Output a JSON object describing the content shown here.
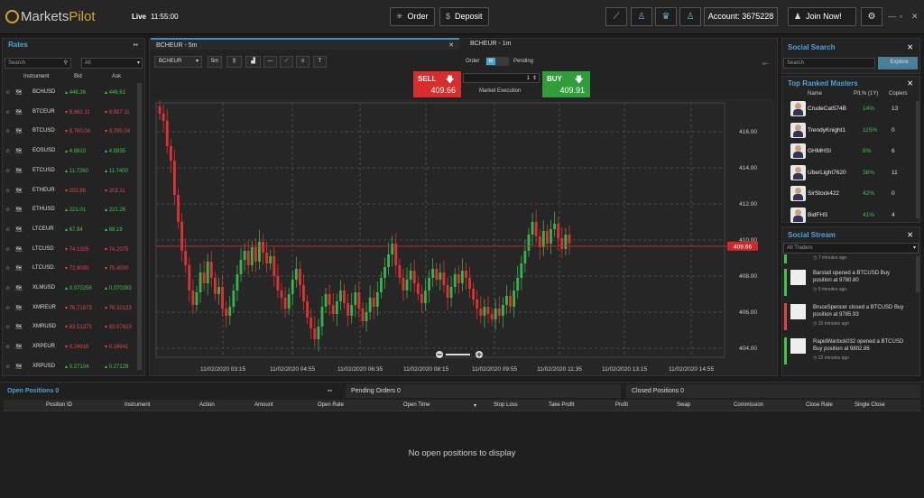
{
  "header": {
    "logo_markets": "Markets",
    "logo_pilot": "Pilot",
    "live": "Live",
    "time": "11:55:00",
    "order": "Order",
    "deposit": "Deposit",
    "account": "Account: 3675228",
    "join": "Join Now!"
  },
  "rates": {
    "title": "Rates",
    "search_placeholder": "Search",
    "filter": "All",
    "col_instrument": "Instrument",
    "col_bid": "Bid",
    "col_ask": "Ask",
    "rows": [
      {
        "inst": "BCHUSD",
        "bid": "446.36",
        "ask": "446.61",
        "dir": "up"
      },
      {
        "inst": "BTCEUR",
        "bid": "8,862.11",
        "ask": "8,887.11",
        "dir": "dn"
      },
      {
        "inst": "BTCUSD",
        "bid": "9,760.04",
        "ask": "9,785.04",
        "dir": "dn"
      },
      {
        "inst": "EOSUSD",
        "bid": "4.8910",
        "ask": "4.8935",
        "dir": "up"
      },
      {
        "inst": "ETCUSD",
        "bid": "11.7260",
        "ask": "11.7400",
        "dir": "up"
      },
      {
        "inst": "ETHEUR",
        "bid": "202.86",
        "ask": "203.11",
        "dir": "dn"
      },
      {
        "inst": "ETHUSD",
        "bid": "221.01",
        "ask": "221.26",
        "dir": "up"
      },
      {
        "inst": "LTCEUR",
        "bid": "67.94",
        "ask": "68.19",
        "dir": "up"
      },
      {
        "inst": "LTCUSD",
        "bid": "74.1325",
        "ask": "74.2075",
        "dir": "dn"
      },
      {
        "inst": "LTCUSD.",
        "bid": "72.9000",
        "ask": "75.4000",
        "dir": "dn"
      },
      {
        "inst": "XLMUSD",
        "bid": "0.070258",
        "ask": "0.070283",
        "dir": "up"
      },
      {
        "inst": "XMREUR",
        "bid": "76.71873",
        "ask": "76.32123",
        "dir": "dn"
      },
      {
        "inst": "XMRUSD",
        "bid": "83.51373",
        "ask": "83.57623",
        "dir": "dn"
      },
      {
        "inst": "XRPEUR",
        "bid": "0.24916",
        "ask": "0.24941",
        "dir": "dn"
      },
      {
        "inst": "XRPUSD",
        "bid": "0.27104",
        "ask": "0.27129",
        "dir": "up"
      }
    ]
  },
  "tabs": [
    {
      "label": "BCHEUR - 5m"
    },
    {
      "label": "BCHEUR - 1m"
    }
  ],
  "toolbar": {
    "symbol": "BCHEUR",
    "interval": "5m",
    "text_tool": "T"
  },
  "trade": {
    "sell_label": "SELL",
    "sell_price": "409.66",
    "buy_label": "BUY",
    "buy_price": "409.91",
    "order": "Order",
    "toggle": "M",
    "pending": "Pending",
    "qty": "1",
    "execution": "Market Execution"
  },
  "chart_data": {
    "type": "candlestick",
    "ylim": [
      403.5,
      417.6
    ],
    "yticks": [
      "416.00",
      "414.00",
      "412.00",
      "410.00",
      "408.00",
      "406.00",
      "404.00"
    ],
    "xticks": [
      "11/02/2020 03:15",
      "11/02/2020 04:55",
      "11/02/2020 06:35",
      "11/02/2020 08:15",
      "11/02/2020 09:55",
      "11/02/2020 11:35",
      "11/02/2020 13:15",
      "11/02/2020 14:55"
    ],
    "current_price": 409.66,
    "current_label": "409.66",
    "close": [
      417.0,
      416.6,
      415.2,
      414.4,
      412.5,
      411.0,
      409.4,
      408.6,
      407.2,
      406.4,
      407.1,
      408.2,
      407.6,
      408.8,
      407.9,
      407.0,
      407.4,
      406.2,
      405.8,
      406.3,
      407.2,
      408.1,
      408.9,
      409.4,
      408.6,
      409.6,
      408.8,
      409.9,
      409.3,
      408.7,
      409.1,
      408.0,
      407.2,
      406.8,
      406.2,
      407.0,
      407.8,
      408.4,
      407.5,
      406.6,
      405.7,
      405.1,
      404.5,
      405.2,
      406.3,
      407.0,
      406.4,
      405.9,
      406.6,
      407.2,
      406.5,
      405.8,
      406.4,
      407.1,
      406.2,
      405.5,
      406.0,
      406.8,
      406.3,
      407.1,
      407.9,
      408.5,
      409.2,
      409.8,
      408.6,
      407.9,
      407.2,
      407.8,
      408.3,
      407.6,
      407.0,
      406.5,
      407.2,
      407.9,
      408.4,
      407.8,
      408.2,
      407.5,
      406.8,
      407.4,
      408.1,
      407.6,
      408.3,
      407.9,
      407.3,
      406.7,
      406.2,
      405.8,
      406.3,
      405.9,
      405.6,
      406.2,
      405.8,
      406.4,
      406.9,
      406.3,
      407.2,
      407.9,
      408.7,
      409.4,
      410.3,
      411.0,
      410.2,
      409.6,
      410.5,
      409.8,
      410.6,
      410.9,
      410.1,
      409.5,
      410.3,
      409.8
    ]
  },
  "social_search": {
    "title": "Social Search",
    "placeholder": "Search",
    "explore": "Explore"
  },
  "masters": {
    "title": "Top Ranked Masters",
    "col_name": "Name",
    "col_pl": "P/L% (1Y)",
    "col_copiers": "Copiers",
    "rows": [
      {
        "name": "CrudeCat574B",
        "pl": "14%",
        "copiers": "13"
      },
      {
        "name": "TrendyKnight1",
        "pl": "115%",
        "copiers": "0"
      },
      {
        "name": "GHMHSI",
        "pl": "8%",
        "copiers": "6"
      },
      {
        "name": "UberLight7620",
        "pl": "36%",
        "copiers": "11"
      },
      {
        "name": "SirStock422",
        "pl": "42%",
        "copiers": "0"
      },
      {
        "name": "BidFHS",
        "pl": "41%",
        "copiers": "4"
      }
    ]
  },
  "stream": {
    "title": "Social Stream",
    "filter": "All Traders",
    "items": [
      {
        "text": "",
        "time": "7 minutes ago",
        "color": "#3ec64a"
      },
      {
        "text": "Barstall opened a BTCUSD Buy position at 9780.80",
        "time": "9 minutes ago",
        "color": "#3ec64a"
      },
      {
        "text": "BruceSpencer closed a BTCUSD Buy position at 9785.93",
        "time": "15 minutes ago",
        "color": "#e24444"
      },
      {
        "text": "RapidWarlock032 opened a BTCUSD Buy position at 9802.86",
        "time": "22 minutes ago",
        "color": "#3ec64a"
      }
    ]
  },
  "bottom": {
    "open_positions": "Open Positions",
    "open_count": "0",
    "pending_orders": "Pending Orders",
    "pending_count": "0",
    "closed_positions": "Closed Positions",
    "closed_count": "0",
    "cols": [
      "Position ID",
      "Instrument",
      "Action",
      "Amount",
      "Open Rate",
      "Open Time",
      "Stop Loss",
      "Take Profit",
      "Profit",
      "Swap",
      "Commission",
      "Close Rate",
      "Single Close"
    ],
    "empty": "No open positions to display"
  }
}
